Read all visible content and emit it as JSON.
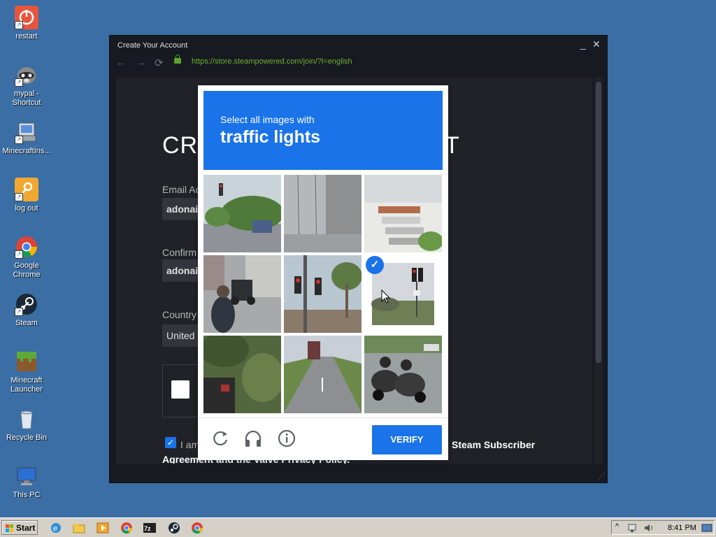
{
  "desktop": {
    "icons": [
      {
        "label": "restart"
      },
      {
        "label": "mypal - Shortcut"
      },
      {
        "label": "MinecraftIns..."
      },
      {
        "label": "log out"
      },
      {
        "label": "Google Chrome"
      },
      {
        "label": "Steam"
      },
      {
        "label": "Minecraft Launcher"
      },
      {
        "label": "Recycle Bin"
      },
      {
        "label": "This PC"
      }
    ]
  },
  "window": {
    "title": "Create Your Account",
    "url": "https://store.steampowered.com/join/?l=english",
    "page": {
      "heading_left": "CR",
      "heading_right": "T",
      "email_label": "Email Ac",
      "email_value": "adonai.",
      "confirm_label": "Confirm",
      "confirm_value": "adonai.",
      "country_label": "Country",
      "country_value": "United",
      "agree_visible_left": "I am",
      "agree_visible_right": "Steam Subscriber",
      "agree_line2": "Agreement and the Valve Privacy Policy."
    }
  },
  "captcha": {
    "prompt_line1": "Select all images with",
    "prompt_line2": "traffic lights",
    "selected_tile_index": 5,
    "verify_label": "VERIFY",
    "tools": [
      "refresh-icon",
      "headphones-icon",
      "info-icon"
    ]
  },
  "taskbar": {
    "start_label": "Start",
    "clock": "8:41 PM",
    "apps": [
      "ie-icon",
      "folder-icon",
      "media-icon",
      "chrome-icon",
      "7zip-icon",
      "steam-icon",
      "chrome-icon"
    ]
  }
}
